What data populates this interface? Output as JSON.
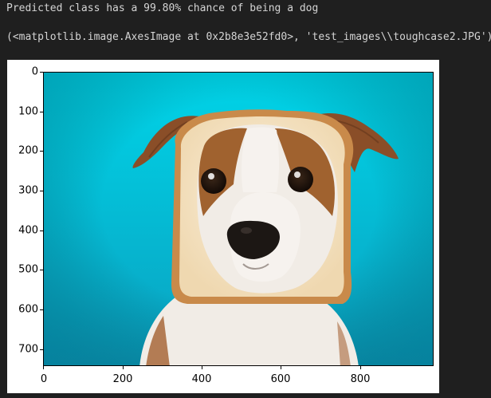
{
  "output": {
    "line1": "Predicted class has a 99.80% chance of being a dog",
    "line2": "(<matplotlib.image.AxesImage at 0x2b8e3e52fd0>, 'test_images\\\\toughcase2.JPG')"
  },
  "figure": {
    "image_description": "Photo of a Jack Russell terrier with its head framed through a slice of bread, against a turquoise background",
    "yticks": [
      "0",
      "100",
      "200",
      "300",
      "400",
      "500",
      "600",
      "700"
    ],
    "xticks": [
      "0",
      "200",
      "400",
      "600",
      "800"
    ],
    "colors": {
      "background_top": "#00d4e8",
      "background_bottom": "#0aa0bf",
      "bread_crust": "#c98a4a",
      "bread_inner": "#f6e6c8",
      "fur_white": "#f1ece6",
      "fur_brown": "#9a5a2e"
    }
  }
}
